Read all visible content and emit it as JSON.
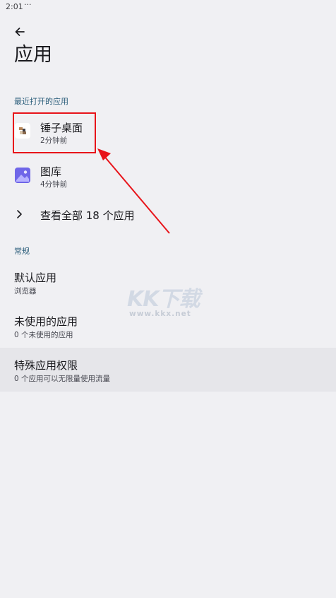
{
  "status_bar": {
    "time": "2:01",
    "dots": "···"
  },
  "header": {
    "title": "应用"
  },
  "recent": {
    "section_label": "最近打开的应用",
    "apps": [
      {
        "name": "锤子桌面",
        "time_ago": "2分钟前",
        "icon": "hammer-launcher-icon"
      },
      {
        "name": "图库",
        "time_ago": "4分钟前",
        "icon": "gallery-icon"
      }
    ],
    "see_all_label": "查看全部 18 个应用"
  },
  "general": {
    "section_label": "常规",
    "items": [
      {
        "title": "默认应用",
        "subtitle": "浏览器"
      },
      {
        "title": "未使用的应用",
        "subtitle": "0 个未使用的应用"
      },
      {
        "title": "特殊应用权限",
        "subtitle": "0 个应用可以无限量使用流量"
      }
    ]
  },
  "watermark": {
    "logo": "KK下载",
    "url": "www.kkx.net"
  },
  "colors": {
    "background": "#f0f0f3",
    "section_label": "#2a5d7a",
    "annotation_red": "#e8141a",
    "gallery_icon": "#6f66e8"
  }
}
